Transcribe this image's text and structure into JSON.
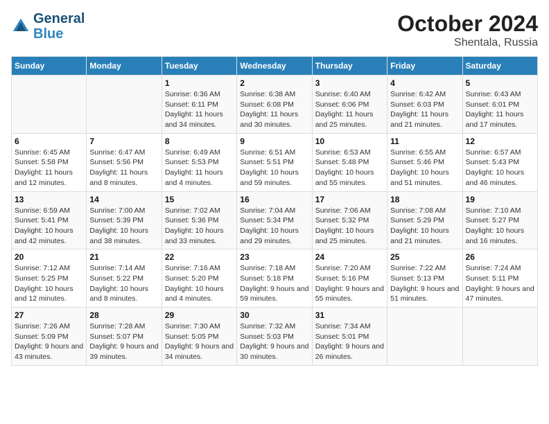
{
  "logo": {
    "general": "General",
    "blue": "Blue"
  },
  "title": "October 2024",
  "subtitle": "Shentala, Russia",
  "days_of_week": [
    "Sunday",
    "Monday",
    "Tuesday",
    "Wednesday",
    "Thursday",
    "Friday",
    "Saturday"
  ],
  "weeks": [
    [
      {
        "day": "",
        "sunrise": "",
        "sunset": "",
        "daylight": ""
      },
      {
        "day": "",
        "sunrise": "",
        "sunset": "",
        "daylight": ""
      },
      {
        "day": "1",
        "sunrise": "Sunrise: 6:36 AM",
        "sunset": "Sunset: 6:11 PM",
        "daylight": "Daylight: 11 hours and 34 minutes."
      },
      {
        "day": "2",
        "sunrise": "Sunrise: 6:38 AM",
        "sunset": "Sunset: 6:08 PM",
        "daylight": "Daylight: 11 hours and 30 minutes."
      },
      {
        "day": "3",
        "sunrise": "Sunrise: 6:40 AM",
        "sunset": "Sunset: 6:06 PM",
        "daylight": "Daylight: 11 hours and 25 minutes."
      },
      {
        "day": "4",
        "sunrise": "Sunrise: 6:42 AM",
        "sunset": "Sunset: 6:03 PM",
        "daylight": "Daylight: 11 hours and 21 minutes."
      },
      {
        "day": "5",
        "sunrise": "Sunrise: 6:43 AM",
        "sunset": "Sunset: 6:01 PM",
        "daylight": "Daylight: 11 hours and 17 minutes."
      }
    ],
    [
      {
        "day": "6",
        "sunrise": "Sunrise: 6:45 AM",
        "sunset": "Sunset: 5:58 PM",
        "daylight": "Daylight: 11 hours and 12 minutes."
      },
      {
        "day": "7",
        "sunrise": "Sunrise: 6:47 AM",
        "sunset": "Sunset: 5:56 PM",
        "daylight": "Daylight: 11 hours and 8 minutes."
      },
      {
        "day": "8",
        "sunrise": "Sunrise: 6:49 AM",
        "sunset": "Sunset: 5:53 PM",
        "daylight": "Daylight: 11 hours and 4 minutes."
      },
      {
        "day": "9",
        "sunrise": "Sunrise: 6:51 AM",
        "sunset": "Sunset: 5:51 PM",
        "daylight": "Daylight: 10 hours and 59 minutes."
      },
      {
        "day": "10",
        "sunrise": "Sunrise: 6:53 AM",
        "sunset": "Sunset: 5:48 PM",
        "daylight": "Daylight: 10 hours and 55 minutes."
      },
      {
        "day": "11",
        "sunrise": "Sunrise: 6:55 AM",
        "sunset": "Sunset: 5:46 PM",
        "daylight": "Daylight: 10 hours and 51 minutes."
      },
      {
        "day": "12",
        "sunrise": "Sunrise: 6:57 AM",
        "sunset": "Sunset: 5:43 PM",
        "daylight": "Daylight: 10 hours and 46 minutes."
      }
    ],
    [
      {
        "day": "13",
        "sunrise": "Sunrise: 6:59 AM",
        "sunset": "Sunset: 5:41 PM",
        "daylight": "Daylight: 10 hours and 42 minutes."
      },
      {
        "day": "14",
        "sunrise": "Sunrise: 7:00 AM",
        "sunset": "Sunset: 5:39 PM",
        "daylight": "Daylight: 10 hours and 38 minutes."
      },
      {
        "day": "15",
        "sunrise": "Sunrise: 7:02 AM",
        "sunset": "Sunset: 5:36 PM",
        "daylight": "Daylight: 10 hours and 33 minutes."
      },
      {
        "day": "16",
        "sunrise": "Sunrise: 7:04 AM",
        "sunset": "Sunset: 5:34 PM",
        "daylight": "Daylight: 10 hours and 29 minutes."
      },
      {
        "day": "17",
        "sunrise": "Sunrise: 7:06 AM",
        "sunset": "Sunset: 5:32 PM",
        "daylight": "Daylight: 10 hours and 25 minutes."
      },
      {
        "day": "18",
        "sunrise": "Sunrise: 7:08 AM",
        "sunset": "Sunset: 5:29 PM",
        "daylight": "Daylight: 10 hours and 21 minutes."
      },
      {
        "day": "19",
        "sunrise": "Sunrise: 7:10 AM",
        "sunset": "Sunset: 5:27 PM",
        "daylight": "Daylight: 10 hours and 16 minutes."
      }
    ],
    [
      {
        "day": "20",
        "sunrise": "Sunrise: 7:12 AM",
        "sunset": "Sunset: 5:25 PM",
        "daylight": "Daylight: 10 hours and 12 minutes."
      },
      {
        "day": "21",
        "sunrise": "Sunrise: 7:14 AM",
        "sunset": "Sunset: 5:22 PM",
        "daylight": "Daylight: 10 hours and 8 minutes."
      },
      {
        "day": "22",
        "sunrise": "Sunrise: 7:16 AM",
        "sunset": "Sunset: 5:20 PM",
        "daylight": "Daylight: 10 hours and 4 minutes."
      },
      {
        "day": "23",
        "sunrise": "Sunrise: 7:18 AM",
        "sunset": "Sunset: 5:18 PM",
        "daylight": "Daylight: 9 hours and 59 minutes."
      },
      {
        "day": "24",
        "sunrise": "Sunrise: 7:20 AM",
        "sunset": "Sunset: 5:16 PM",
        "daylight": "Daylight: 9 hours and 55 minutes."
      },
      {
        "day": "25",
        "sunrise": "Sunrise: 7:22 AM",
        "sunset": "Sunset: 5:13 PM",
        "daylight": "Daylight: 9 hours and 51 minutes."
      },
      {
        "day": "26",
        "sunrise": "Sunrise: 7:24 AM",
        "sunset": "Sunset: 5:11 PM",
        "daylight": "Daylight: 9 hours and 47 minutes."
      }
    ],
    [
      {
        "day": "27",
        "sunrise": "Sunrise: 7:26 AM",
        "sunset": "Sunset: 5:09 PM",
        "daylight": "Daylight: 9 hours and 43 minutes."
      },
      {
        "day": "28",
        "sunrise": "Sunrise: 7:28 AM",
        "sunset": "Sunset: 5:07 PM",
        "daylight": "Daylight: 9 hours and 39 minutes."
      },
      {
        "day": "29",
        "sunrise": "Sunrise: 7:30 AM",
        "sunset": "Sunset: 5:05 PM",
        "daylight": "Daylight: 9 hours and 34 minutes."
      },
      {
        "day": "30",
        "sunrise": "Sunrise: 7:32 AM",
        "sunset": "Sunset: 5:03 PM",
        "daylight": "Daylight: 9 hours and 30 minutes."
      },
      {
        "day": "31",
        "sunrise": "Sunrise: 7:34 AM",
        "sunset": "Sunset: 5:01 PM",
        "daylight": "Daylight: 9 hours and 26 minutes."
      },
      {
        "day": "",
        "sunrise": "",
        "sunset": "",
        "daylight": ""
      },
      {
        "day": "",
        "sunrise": "",
        "sunset": "",
        "daylight": ""
      }
    ]
  ]
}
